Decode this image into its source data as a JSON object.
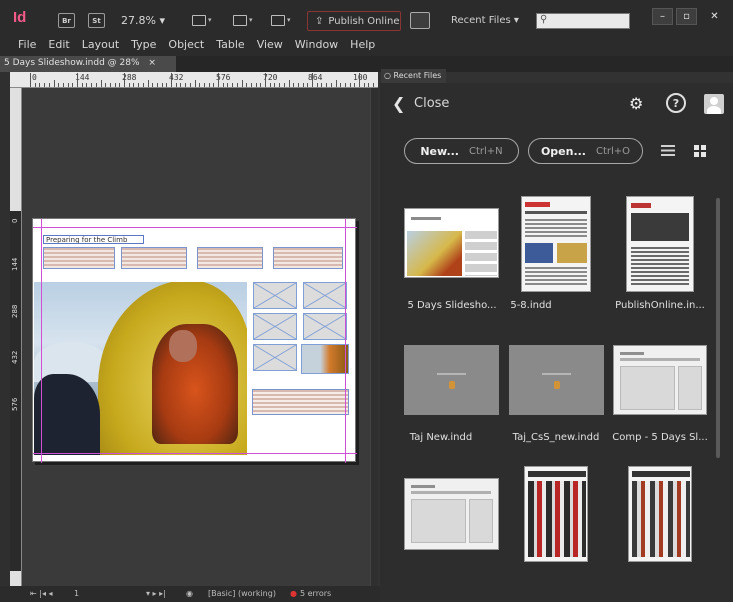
{
  "app": {
    "logo": "Id",
    "bridge_label": "Br",
    "stock_label": "St",
    "zoom": "27.8%",
    "publish_online": "Publish Online",
    "recent_files_dropdown": "Recent Files",
    "window_buttons": [
      "–",
      "▫",
      "✕"
    ]
  },
  "menu": [
    "File",
    "Edit",
    "Layout",
    "Type",
    "Object",
    "Table",
    "View",
    "Window",
    "Help"
  ],
  "document": {
    "tab_title": "5 Days Slideshow.indd @ 28%",
    "tab_close": "×",
    "ruler_labels": [
      "0",
      "144",
      "288",
      "432",
      "576",
      "720",
      "864",
      "100"
    ],
    "vertical_ruler_labels": [
      "0",
      "144",
      "288",
      "432",
      "576"
    ],
    "headline": "Preparing for the Climb"
  },
  "status_bar": {
    "page": "1",
    "style": "[Basic] (working)",
    "errors": "5 errors"
  },
  "recent_panel": {
    "tab_label": "Recent Files",
    "close_label": "Close",
    "new_button": "New...",
    "new_shortcut": "Ctrl+N",
    "open_button": "Open...",
    "open_shortcut": "Ctrl+O",
    "files": [
      {
        "name": "5 Days Slidesho..."
      },
      {
        "name": "5-8.indd"
      },
      {
        "name": "PublishOnline.in..."
      },
      {
        "name": "Taj New.indd"
      },
      {
        "name": "Taj_CsS_new.indd"
      },
      {
        "name": "Comp - 5 Days Sl..."
      }
    ]
  },
  "colors": {
    "app_bg": "#323232",
    "logo": "#f35a8a",
    "guide": "#d04fd6",
    "frame": "#7a94cf"
  },
  "icons": [
    "search-icon",
    "gear-icon",
    "help-icon",
    "user-icon",
    "list-view-icon",
    "grid-view-icon",
    "back-chevron-icon"
  ]
}
